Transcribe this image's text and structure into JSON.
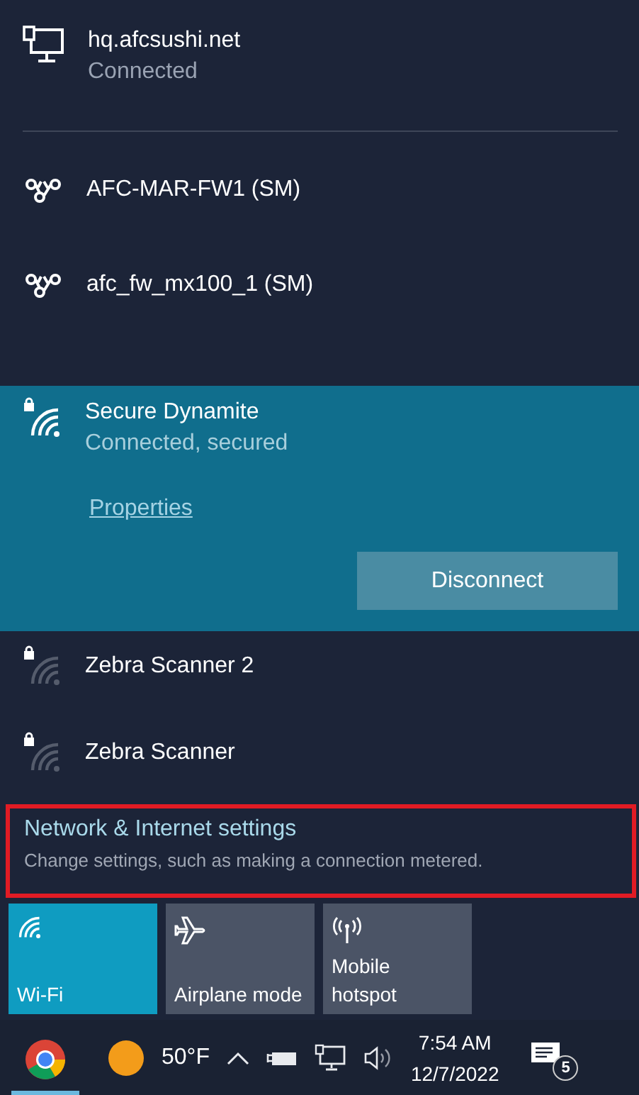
{
  "ethernet": {
    "name": "hq.afcsushi.net",
    "status": "Connected"
  },
  "vpns": [
    {
      "name": "AFC-MAR-FW1 (SM)"
    },
    {
      "name": "afc_fw_mx100_1 (SM)"
    }
  ],
  "wifi_networks": [
    {
      "name": "Secure Dynamite",
      "selected": true,
      "status": "Connected, secured",
      "link": "Properties",
      "button": "Disconnect"
    },
    {
      "name": "Zebra Scanner 2",
      "selected": false
    },
    {
      "name": "Zebra Scanner",
      "selected": false
    }
  ],
  "settings_link": {
    "title": "Network & Internet settings",
    "description": "Change settings, such as making a connection metered."
  },
  "quick_actions": [
    {
      "kind": "wifi",
      "label": "Wi-Fi",
      "on": true
    },
    {
      "kind": "airplane",
      "label": "Airplane mode",
      "on": false
    },
    {
      "kind": "hotspot",
      "label": "Mobile\nhotspot",
      "on": false
    }
  ],
  "taskbar": {
    "weather": "50°F",
    "time": "7:54 AM",
    "date": "12/7/2022",
    "notifications": "5"
  }
}
